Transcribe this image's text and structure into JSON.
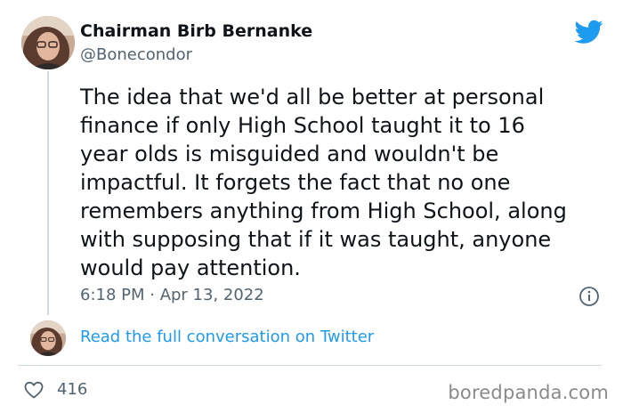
{
  "tweet": {
    "author_name": "Chairman Birb Bernanke",
    "author_handle": "@Bonecondor",
    "text": "The idea that we'd all be better at personal\nfinance if only High School taught it to 16\nyear olds is misguided and wouldn't be\nimpactful. It forgets the fact that no one\nremembers anything from High School, along\nwith supposing that if it was taught, anyone\nwould pay attention.",
    "timestamp": "6:18 PM · Apr 13, 2022"
  },
  "conversation": {
    "link_label": "Read the full conversation on Twitter"
  },
  "engagement": {
    "likes": "416"
  },
  "watermark": {
    "text": "boredpanda.com"
  },
  "icons": {
    "brand": "twitter-bird-icon",
    "info": "info-icon",
    "like": "heart-icon"
  },
  "colors": {
    "brand_blue": "#1d9bf0",
    "text_primary": "#0f1419",
    "text_secondary": "#536471",
    "border": "#cfd9de",
    "watermark": "#8a8a8a"
  }
}
